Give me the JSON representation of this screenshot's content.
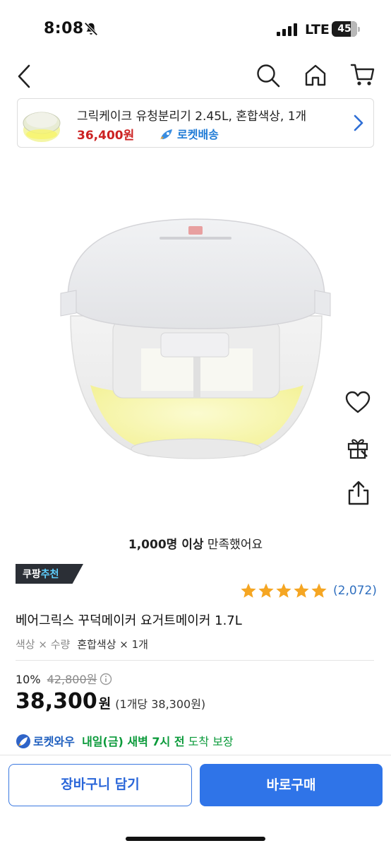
{
  "status_bar": {
    "time": "8:08",
    "carrier": "LTE",
    "battery": "45"
  },
  "nav": {
    "icons": [
      "back-icon",
      "search-icon",
      "home-icon",
      "cart-icon"
    ]
  },
  "banner": {
    "title": "그릭케이크 유청분리기 2.45L, 혼합색상, 1개",
    "price": "36,400원",
    "delivery": "로켓배송"
  },
  "satisfaction": {
    "count": "1,000명 이상",
    "text": " 만족했어요"
  },
  "reco_badge": {
    "brand": "쿠팡",
    "label": "추천"
  },
  "rating": {
    "stars": 5,
    "max": 5,
    "review_count": "(2,072)"
  },
  "product": {
    "name": "베어그릭스 꾸덕메이커 요거트메이커 1.7L",
    "option_label": "색상 × 수량",
    "option_value": "혼합색상 × 1개",
    "discount_rate": "10%",
    "original_price": "42,800원",
    "sale_amount": "38,300",
    "sale_currency": "원",
    "unit_price": "(1개당 38,300원)"
  },
  "delivery": {
    "brand": "로켓와우",
    "date": "내일(금) 새벽 7시 전",
    "suffix": " 도착 보장"
  },
  "buttons": {
    "cart": "장바구니 담기",
    "buy": "바로구매"
  },
  "colors": {
    "accent_blue": "#2f74e8",
    "price_red": "#cc2222",
    "rocket_blue": "#1f7bd6",
    "star_orange": "#f5a623",
    "delivery_green": "#0a9a3a"
  }
}
